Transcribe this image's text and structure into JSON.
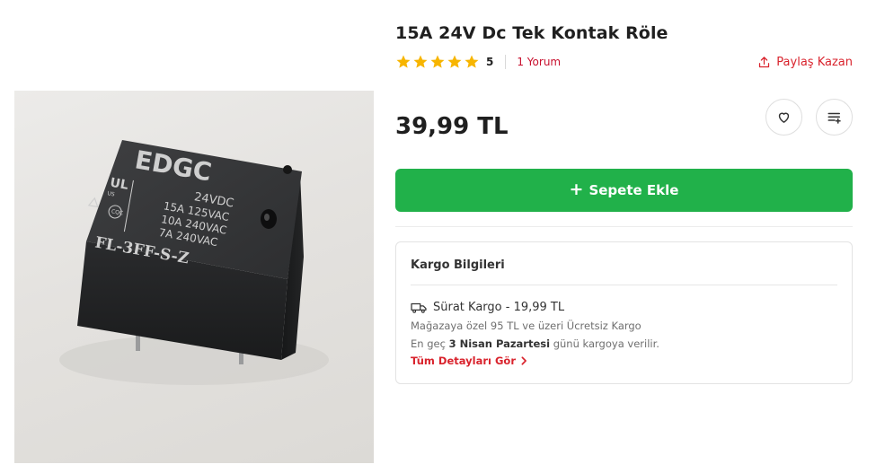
{
  "product": {
    "title": "15A 24V Dc Tek Kontak Röle",
    "image_alt": "relay-photo",
    "image_printed": {
      "brand": "EDGC",
      "voltage": "24VDC",
      "spec1": "15A  125VAC",
      "spec2": "10A  240VAC",
      "spec3": "7A    240VAC",
      "model": "FL-3FF-S-Z",
      "ul": "UL",
      "us": "US",
      "cqc": "CQC"
    }
  },
  "rating": {
    "value": "5",
    "stars": 5,
    "review_link": "1 Yorum",
    "star_color": "#f7b500"
  },
  "share": {
    "label": "Paylaş Kazan",
    "icon": "share-icon"
  },
  "price": {
    "text": "39,99 TL"
  },
  "actions": {
    "favorite_icon": "heart-icon",
    "list_icon": "add-to-list-icon",
    "add_to_cart_label": "Sepete Ekle",
    "add_to_cart_color": "#21b14a"
  },
  "cargo": {
    "title": "Kargo Bilgileri",
    "shipping_line": "Sürat Kargo - 19,99 TL",
    "free_shipping_note": "Mağazaya özel 95 TL ve üzeri Ücretsiz Kargo",
    "delivery_prefix": "En geç",
    "delivery_date": "3 Nisan Pazartesi",
    "delivery_suffix": "günü kargoya verilir.",
    "details_link": "Tüm Detayları Gör",
    "accent_color": "#d9232d"
  }
}
